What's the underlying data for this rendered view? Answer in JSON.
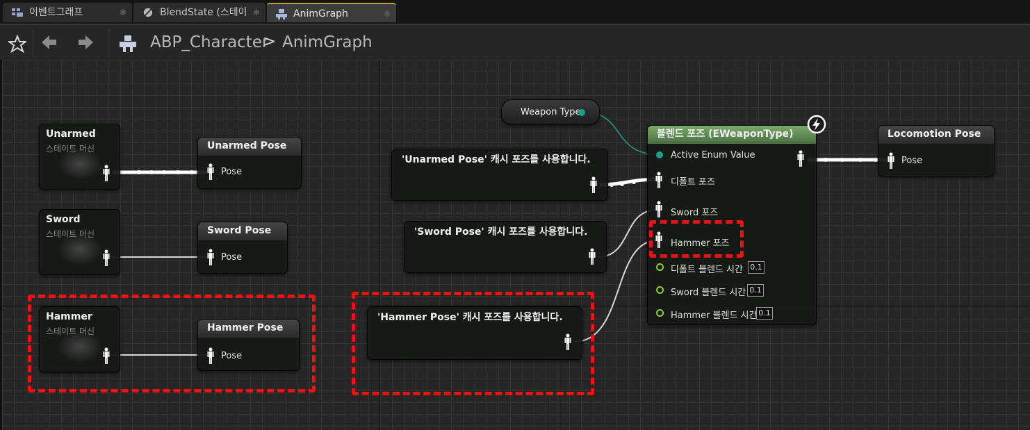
{
  "tabs": [
    {
      "label": "이벤트그래프",
      "icon": "event-graph-icon"
    },
    {
      "label": "BlendState (스테이",
      "icon": "blend-state-icon"
    },
    {
      "label": "AnimGraph",
      "icon": "anim-graph-icon",
      "active": true
    }
  ],
  "breadcrumb": {
    "root": "ABP_Character",
    "separator": ">",
    "current": "AnimGraph"
  },
  "state_machines": [
    {
      "title": "Unarmed",
      "subtitle": "스테이트 머신"
    },
    {
      "title": "Sword",
      "subtitle": "스테이트 머신"
    },
    {
      "title": "Hammer",
      "subtitle": "스테이트 머신"
    }
  ],
  "cache_save_nodes": [
    {
      "title": "Unarmed Pose",
      "pin": "Pose"
    },
    {
      "title": "Sword Pose",
      "pin": "Pose"
    },
    {
      "title": "Hammer Pose",
      "pin": "Pose"
    }
  ],
  "cache_use_nodes": [
    {
      "title": "'Unarmed Pose' 캐시 포즈를 사용합니다."
    },
    {
      "title": "'Sword Pose' 캐시 포즈를 사용합니다."
    },
    {
      "title": "'Hammer Pose' 캐시 포즈를 사용합니다."
    }
  ],
  "weapon_type_node": {
    "label": "Weapon Type"
  },
  "blend_node": {
    "title": "블렌드 포즈 (EWeaponType)",
    "accent": "#6a9a5a",
    "enum_pin": "Active Enum Value",
    "default_pose": "디폴트 포즈",
    "sword_pose": "Sword 포즈",
    "hammer_pose": "Hammer 포즈",
    "blend_times": [
      {
        "label": "디폴트 블렌드 시간",
        "value": "0.1"
      },
      {
        "label": "Sword 블렌드 시간",
        "value": "0.1"
      },
      {
        "label": "Hammer 블렌드 시간",
        "value": "0.1"
      }
    ]
  },
  "output_node": {
    "title": "Locomotion Pose",
    "pin": "Pose"
  },
  "colors": {
    "highlight": "#ee1111",
    "exec_wire": "#ffffff",
    "enum_wire": "#1e9f8c",
    "float_pin": "#8fd13a"
  }
}
